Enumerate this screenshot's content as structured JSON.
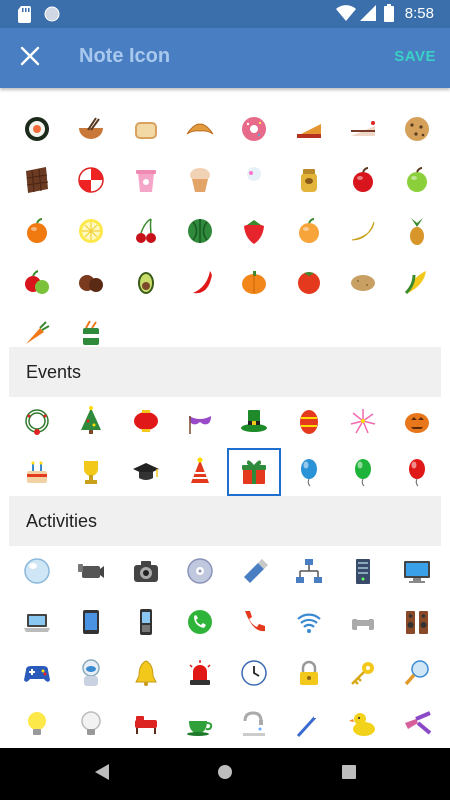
{
  "status_bar": {
    "time": "8:58",
    "left_icons": [
      "sd-card-icon",
      "circle-icon"
    ],
    "right_icons": [
      "wifi-icon",
      "signal-icon",
      "battery-icon"
    ]
  },
  "app_bar": {
    "title": "Note Icon",
    "save_label": "SAVE",
    "close_icon": "close-icon",
    "colors": {
      "bar": "#4a7ec2",
      "status": "#3a6fab",
      "title": "#a8c8ee",
      "save": "#3bd0c4"
    }
  },
  "sections": [
    {
      "label": "",
      "icons": [
        "sushi-icon",
        "bowl-icon",
        "bread-icon",
        "croissant-icon",
        "donut-icon",
        "pie-slice-icon",
        "cake-slice-icon",
        "cookie-icon",
        "chocolate-icon",
        "peppermint-candy-icon",
        "yogurt-icon",
        "cupcake-icon",
        "ice-cream-cone-icon",
        "honey-jar-icon",
        "red-apple-icon",
        "green-apple-icon",
        "orange-icon",
        "lemon-slice-icon",
        "cherries-icon",
        "watermelon-icon",
        "strawberry-icon",
        "peach-icon",
        "banana-icon",
        "pineapple-icon",
        "apples-icon",
        "chestnuts-icon",
        "avocado-icon",
        "chili-pepper-icon",
        "pumpkin-icon",
        "tomato-icon",
        "potato-icon",
        "corn-icon",
        "carrot-icon",
        "canned-vegetables-icon"
      ]
    },
    {
      "label": "Events",
      "icons": [
        "christmas-wreath-icon",
        "christmas-tree-icon",
        "chinese-lantern-icon",
        "carnival-mask-icon",
        "leprechaun-hat-icon",
        "easter-egg-icon",
        "fireworks-icon",
        "jack-o-lantern-icon",
        "birthday-cake-icon",
        "trophy-icon",
        "graduation-cap-icon",
        "party-hat-icon",
        "gift-box-icon",
        "blue-balloon-icon",
        "green-balloon-icon",
        "red-balloon-icon"
      ],
      "selected": "gift-box-icon"
    },
    {
      "label": "Activities",
      "icons": [
        "bubble-icon",
        "camcorder-icon",
        "camera-icon",
        "disc-icon",
        "usb-drive-icon",
        "network-icon",
        "server-icon",
        "monitor-icon",
        "laptop-icon",
        "tablet-icon",
        "mobile-phone-icon",
        "green-phone-icon",
        "phone-handset-icon",
        "wifi-signal-icon",
        "printer-icon",
        "speakers-icon",
        "gamepad-icon",
        "robot-icon",
        "bell-icon",
        "siren-icon",
        "clock-icon",
        "padlock-icon",
        "key-icon",
        "magnifier-icon",
        "light-bulb-icon",
        "bulb-off-icon",
        "furniture-icon",
        "tea-cup-icon",
        "faucet-icon",
        "toothbrush-icon",
        "rubber-duck-icon",
        "pliers-icon"
      ]
    }
  ],
  "nav_bar": {
    "icons": [
      "back-icon",
      "home-icon",
      "recents-icon"
    ]
  }
}
